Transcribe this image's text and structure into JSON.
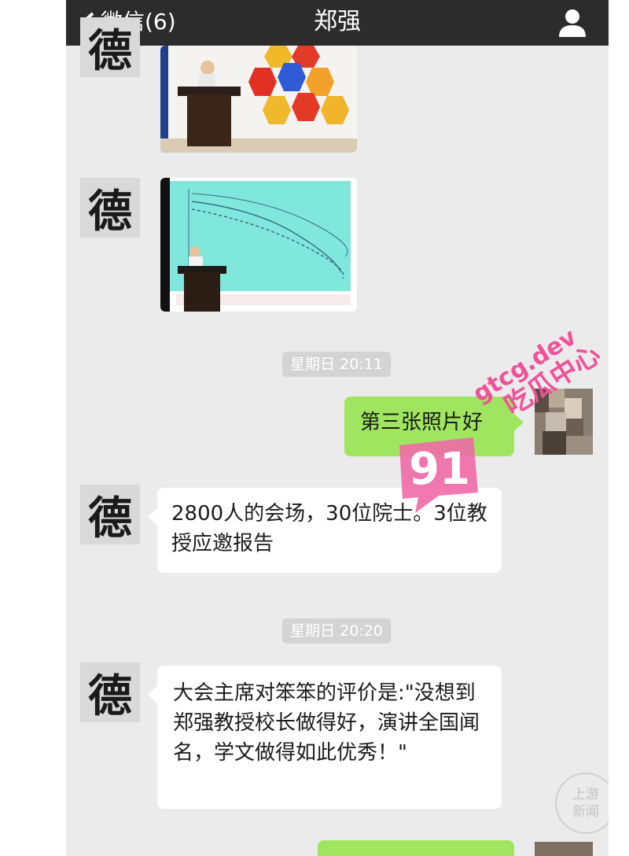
{
  "nav": {
    "back_label": "微信(6)",
    "title": "郑强"
  },
  "contact_avatar": {
    "char": "德"
  },
  "messages": [
    {
      "type": "image",
      "from": "contact",
      "desc": "speaker at podium with colored hexagon slide"
    },
    {
      "type": "image",
      "from": "contact",
      "desc": "speaker at podium with graph slide"
    },
    {
      "type": "time",
      "text": "星期日 20:11"
    },
    {
      "type": "text",
      "from": "self",
      "text": "第三张照片好"
    },
    {
      "type": "text",
      "from": "contact",
      "text": "2800人的会场，30位院士。3位教授应邀报告"
    },
    {
      "type": "time",
      "text": "星期日 20:20"
    },
    {
      "type": "text",
      "from": "contact",
      "text": "大会主席对笨笨的评价是:\"没想到郑强教授校长做得好，演讲全国闻名，学文做得如此优秀！\""
    }
  ],
  "watermark": {
    "site": "gtcg.dev",
    "brand": "吃瓜中心",
    "badge": "91",
    "corner": "上游新闻"
  },
  "colors": {
    "nav_bg": "#2c2c2c",
    "chat_bg": "#ebebeb",
    "self_bubble": "#9fe55f",
    "contact_bubble": "#ffffff",
    "watermark": "#f0529a"
  }
}
